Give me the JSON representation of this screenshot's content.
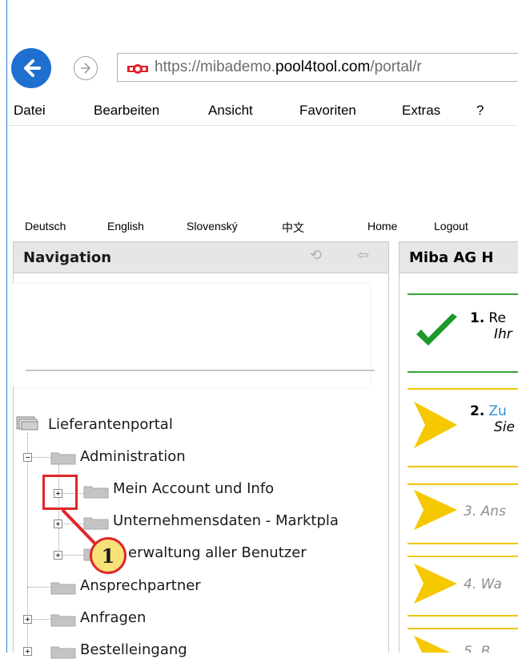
{
  "browser": {
    "url_protocol": "https://",
    "url_domain_prefix": "mibademo.",
    "url_domain": "pool4tool.com",
    "url_path": "/portal/r"
  },
  "menu": [
    "Datei",
    "Bearbeiten",
    "Ansicht",
    "Favoriten",
    "Extras",
    "?"
  ],
  "languages": [
    "Deutsch",
    "English",
    "Slovenský",
    "中文"
  ],
  "top_links": [
    "Home",
    "Logout"
  ],
  "navigation": {
    "title": "Navigation",
    "tree": {
      "root": "Lieferantenportal",
      "administration": "Administration",
      "mein_account": "Mein Account und Info",
      "unternehmensdaten": "Unternehmensdaten - Marktpla",
      "verwaltung": "erwaltung aller Benutzer",
      "ansprechpartner": "Ansprechpartner",
      "anfragen": "Anfragen",
      "bestelleingang": "Bestelleingang"
    }
  },
  "callout": {
    "number": "1"
  },
  "right_panel": {
    "title": "Miba AG H",
    "steps": [
      {
        "num": "1.",
        "text": "Re",
        "sub": "Ihr"
      },
      {
        "num": "2.",
        "text": "Zu",
        "sub": "Sie"
      },
      {
        "text": "3. Ans"
      },
      {
        "text": "4. Wa"
      },
      {
        "text": "5. B"
      }
    ]
  },
  "colors": {
    "accent_blue": "#1f6fd1",
    "callout_red": "#e0262a",
    "callout_fill": "#f7e27a",
    "step_green": "#3aa335",
    "step_yellow": "#f2c500",
    "link_blue": "#2a8fd8"
  }
}
